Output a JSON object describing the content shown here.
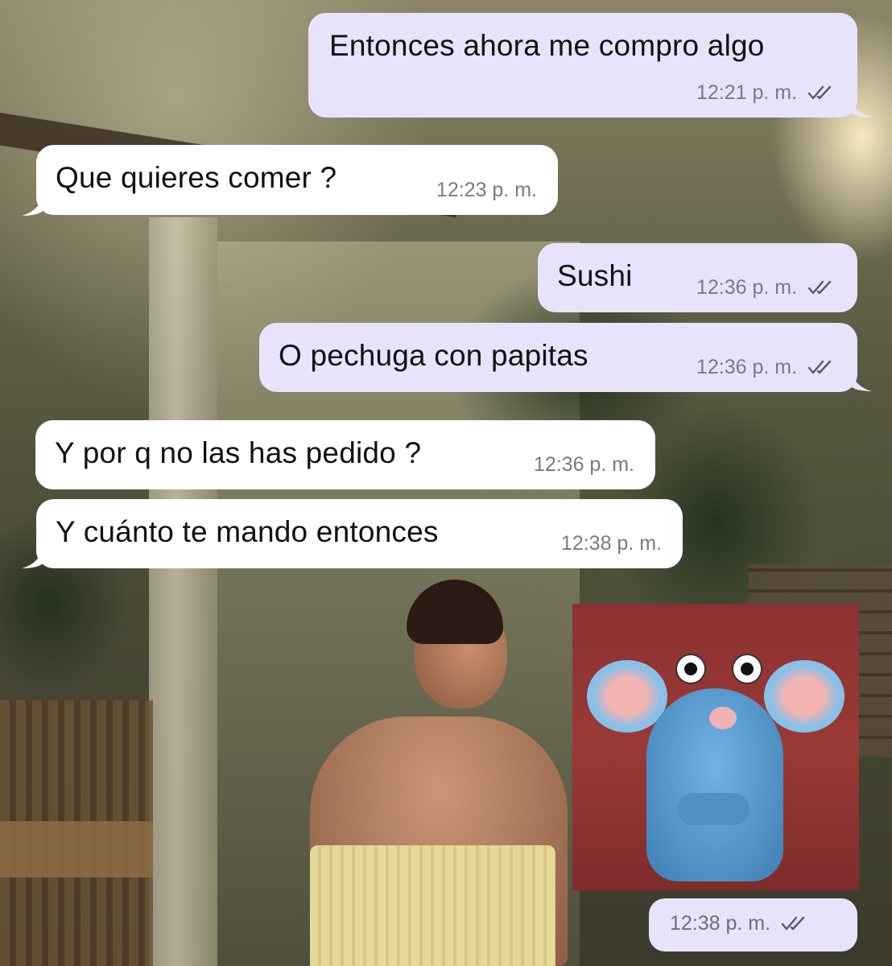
{
  "conversation": {
    "messages": [
      {
        "direction": "outgoing",
        "text": "Entonces ahora me compro algo",
        "time": "12:21 p. m.",
        "status": "read"
      },
      {
        "direction": "incoming",
        "text": "Que quieres comer ?",
        "time": "12:23 p. m."
      },
      {
        "direction": "outgoing",
        "text": "Sushi",
        "time": "12:36 p. m.",
        "status": "read"
      },
      {
        "direction": "outgoing",
        "text": "O pechuga con papitas",
        "time": "12:36 p. m.",
        "status": "read"
      },
      {
        "direction": "incoming",
        "text": "Y por q no las has pedido ?",
        "time": "12:36 p. m."
      },
      {
        "direction": "incoming",
        "text": "Y cuánto te mando entonces",
        "time": "12:38 p. m."
      },
      {
        "direction": "outgoing",
        "type": "sticker",
        "sticker_icon": "blue-rat-sticker",
        "time": "12:38 p. m.",
        "status": "read"
      }
    ]
  },
  "colors": {
    "outgoing_bubble": "#e8e3fb",
    "incoming_bubble": "#ffffff",
    "time_text": "#7a7a82",
    "ticks": "#5a5a62"
  },
  "icons": {
    "read_status": "double-check-icon",
    "background": "chat-wallpaper-photo"
  }
}
